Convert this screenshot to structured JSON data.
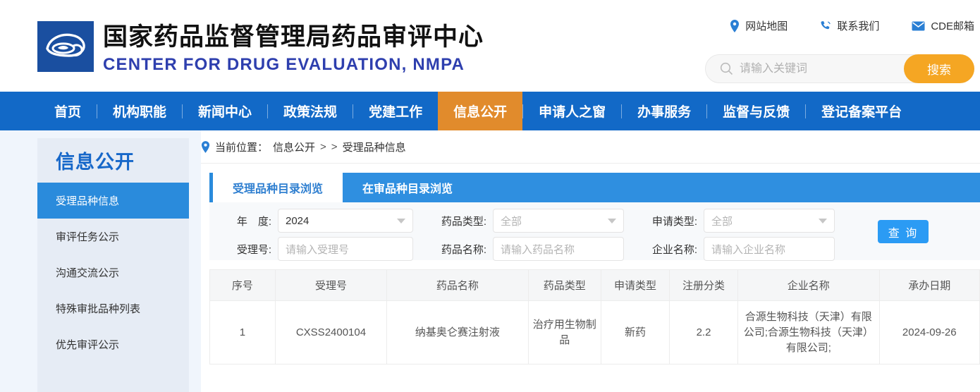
{
  "header": {
    "logo_icon": "cde-eye-logo-icon",
    "title_cn": "国家药品监督管理局药品审评中心",
    "title_en": "CENTER FOR DRUG EVALUATION, NMPA",
    "util_links": [
      {
        "label": "网站地图",
        "icon": "location-pin-icon"
      },
      {
        "label": "联系我们",
        "icon": "phone-icon"
      },
      {
        "label": "CDE邮箱",
        "icon": "envelope-icon"
      }
    ],
    "search": {
      "icon": "search-icon",
      "placeholder": "请输入关键词",
      "value": "",
      "button_label": "搜索",
      "button_color": "#F5A623"
    }
  },
  "nav": {
    "active_color": "#E18B2C",
    "bar_color": "#1269C7",
    "items": [
      {
        "label": "首页",
        "active": false
      },
      {
        "label": "机构职能",
        "active": false
      },
      {
        "label": "新闻中心",
        "active": false
      },
      {
        "label": "政策法规",
        "active": false
      },
      {
        "label": "党建工作",
        "active": false
      },
      {
        "label": "信息公开",
        "active": true
      },
      {
        "label": "申请人之窗",
        "active": false
      },
      {
        "label": "办事服务",
        "active": false
      },
      {
        "label": "监督与反馈",
        "active": false
      },
      {
        "label": "登记备案平台",
        "active": false
      }
    ]
  },
  "sidebar": {
    "title": "信息公开",
    "active_color": "#2A8BDC",
    "items": [
      {
        "label": "受理品种信息",
        "active": true
      },
      {
        "label": "审评任务公示",
        "active": false
      },
      {
        "label": "沟通交流公示",
        "active": false
      },
      {
        "label": "特殊审批品种列表",
        "active": false
      },
      {
        "label": "优先审评公示",
        "active": false
      }
    ]
  },
  "breadcrumb": {
    "icon": "location-pin-icon",
    "prefix": "当前位置：",
    "root": "信息公开",
    "sep1": ">",
    "sep2": ">",
    "current": "受理品种信息"
  },
  "tabs": [
    {
      "label": "受理品种目录浏览",
      "active": true
    },
    {
      "label": "在审品种目录浏览",
      "active": false
    }
  ],
  "filters": {
    "year": {
      "label": "年　度:",
      "value": "2024",
      "is_placeholder": false,
      "type": "select"
    },
    "drug_type": {
      "label": "药品类型:",
      "value": "全部",
      "is_placeholder": true,
      "type": "select"
    },
    "apply_type": {
      "label": "申请类型:",
      "value": "全部",
      "is_placeholder": true,
      "type": "select"
    },
    "accept_no": {
      "label": "受理号:",
      "value": "",
      "placeholder": "请输入受理号",
      "type": "input"
    },
    "drug_name": {
      "label": "药品名称:",
      "value": "",
      "placeholder": "请输入药品名称",
      "type": "input"
    },
    "company_name": {
      "label": "企业名称:",
      "value": "",
      "placeholder": "请输入企业名称",
      "type": "input"
    },
    "query_button": "查 询"
  },
  "table": {
    "columns": [
      "序号",
      "受理号",
      "药品名称",
      "药品类型",
      "申请类型",
      "注册分类",
      "企业名称",
      "承办日期"
    ],
    "rows": [
      {
        "index": "1",
        "accept_no": "CXSS2400104",
        "drug_name": "纳基奥仑赛注射液",
        "drug_type": "治疗用生物制品",
        "apply_type": "新药",
        "reg_class": "2.2",
        "company": "合源生物科技（天津）有限公司;合源生物科技（天津）有限公司;",
        "date": "2024-09-26"
      }
    ]
  }
}
